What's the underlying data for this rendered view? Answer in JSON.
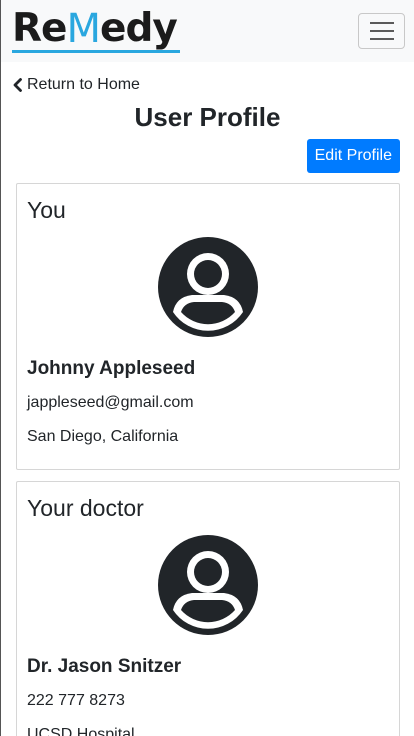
{
  "navbar": {
    "logo_prefix": "Re",
    "logo_m": "M",
    "logo_suffix": "edy",
    "menu_icon": "hamburger-icon"
  },
  "nav": {
    "return_label": "Return to Home",
    "return_icon": "chevron-left-icon"
  },
  "page": {
    "title": "User Profile",
    "edit_label": "Edit Profile"
  },
  "cards": [
    {
      "heading": "You",
      "name": "Johnny Appleseed",
      "email": "jappleseed@gmail.com",
      "location": "San Diego, California"
    },
    {
      "heading": "Your doctor",
      "name": "Dr. Jason Snitzer",
      "phone": "222 777 8273",
      "hospital": "UCSD Hospital"
    }
  ],
  "colors": {
    "accent": "#007bff",
    "logo_accent": "#2aa7df",
    "navbar_bg": "#f8f9fa"
  }
}
